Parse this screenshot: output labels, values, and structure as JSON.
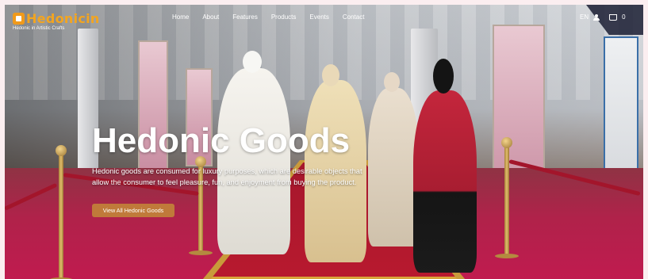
{
  "brand": {
    "logo_text": "Hedonicin",
    "tagline": "Hedonic in Artistic Crafts"
  },
  "nav": {
    "items": [
      "Home",
      "About",
      "Features",
      "Products",
      "Events",
      "Contact"
    ]
  },
  "header_tools": {
    "language": "EN",
    "cart_count": "0"
  },
  "hero": {
    "title": "Hedonic Goods",
    "description": "Hedonic goods are consumed for luxury purposes, which are desirable objects that allow the consumer to feel pleasure, fun, and enjoyment from buying the product.",
    "cta_label": "View All Hedonic Goods"
  },
  "colors": {
    "brand_orange": "#f3a520",
    "cta": "#c07a3a",
    "carpet_red": "#b8192f"
  }
}
